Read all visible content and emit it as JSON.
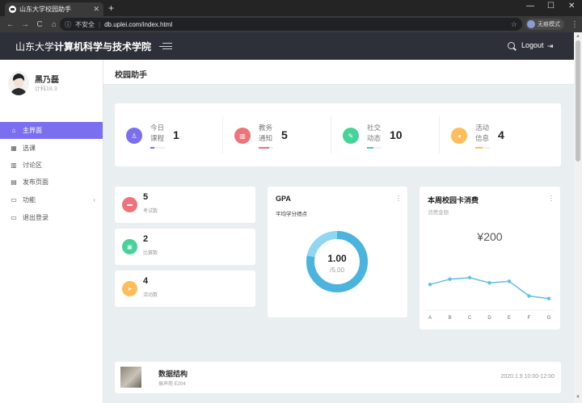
{
  "browser": {
    "tab_title": "山东大学校园助手",
    "tab_close": "✕",
    "new_tab": "+",
    "win_min": "—",
    "win_max": "☐",
    "win_close": "✕",
    "back": "←",
    "forward": "→",
    "reload": "C",
    "home": "⌂",
    "security_label": "不安全",
    "url": "db.uplei.com/index.html",
    "star": "☆",
    "profile_label": "无痕模式",
    "menu": "⋮"
  },
  "header": {
    "brand_prefix": "山东大学",
    "brand_bold": "计算机科学与技术学院",
    "logout": "Logout"
  },
  "user": {
    "name": "黑乃磊",
    "class": "计科18.3"
  },
  "sidebar": {
    "items": [
      {
        "label": "主界面",
        "icon": "home-icon",
        "glyph": "⌂"
      },
      {
        "label": "选课",
        "icon": "grid-icon",
        "glyph": "▦"
      },
      {
        "label": "讨论区",
        "icon": "chart-icon",
        "glyph": "▥"
      },
      {
        "label": "发布页面",
        "icon": "document-icon",
        "glyph": "▤"
      },
      {
        "label": "功能",
        "icon": "window-icon",
        "glyph": "▭"
      },
      {
        "label": "退出登录",
        "icon": "window-icon",
        "glyph": "▭"
      }
    ],
    "caret": "‹"
  },
  "page": {
    "title": "校园助手"
  },
  "stats": [
    {
      "label": "今日课程",
      "value": "1",
      "color": "#7b6ff0",
      "icon": "user-icon",
      "glyph": "♙",
      "fill": 0.3
    },
    {
      "label": "教务通知",
      "value": "5",
      "color": "#f0727a",
      "icon": "trash-icon",
      "glyph": "▥",
      "fill": 0.7
    },
    {
      "label": "社交动态",
      "value": "10",
      "color": "#46d39a",
      "icon": "chat-icon",
      "glyph": "✎",
      "fill": 0.45
    },
    {
      "label": "活动信息",
      "value": "4",
      "color": "#ffbd5a",
      "icon": "megaphone-icon",
      "glyph": "◂",
      "fill": 0.5
    }
  ],
  "small_cards": [
    {
      "value": "5",
      "label": "考试数",
      "color": "#f0727a",
      "icon": "card-icon",
      "glyph": "▬"
    },
    {
      "value": "2",
      "label": "比赛数",
      "color": "#46d39a",
      "icon": "calendar-icon",
      "glyph": "▣"
    },
    {
      "value": "4",
      "label": "活动数",
      "color": "#ffbd5a",
      "icon": "send-icon",
      "glyph": "➤"
    }
  ],
  "gpa": {
    "title": "GPA",
    "subtitle": "平均学分绩点",
    "value": "1.00",
    "max": "/5.00",
    "color": "#4bb4de",
    "track_color": "#8fd6f0"
  },
  "campus_card": {
    "title": "本周校园卡消费",
    "subtitle": "消费金额",
    "amount": "¥200",
    "line_color": "#5fc0e0",
    "chart_data": {
      "type": "line",
      "categories": [
        "A",
        "B",
        "C",
        "D",
        "E",
        "F",
        "G"
      ],
      "values": [
        52,
        62,
        65,
        55,
        58,
        30,
        25
      ],
      "ylim": [
        0,
        100
      ]
    }
  },
  "course": {
    "name": "数据结构",
    "room": "振声苑 E204",
    "time": "2020.1.9 10:00-12:00"
  }
}
